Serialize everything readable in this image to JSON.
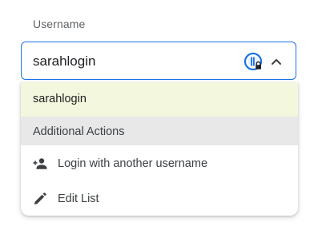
{
  "field": {
    "label": "Username",
    "value": "sarahlogin",
    "accent_color": "#1a73e8"
  },
  "icons": {
    "password_manager": "password-manager-lock-icon",
    "collapse": "chevron-up-icon"
  },
  "dropdown": {
    "suggestion": {
      "label": "sarahlogin",
      "highlight_color": "#f3f7dd"
    },
    "section_header": "Additional Actions",
    "actions": [
      {
        "label": "Login with another username",
        "icon": "add-person-icon"
      },
      {
        "label": "Edit List",
        "icon": "pencil-icon"
      }
    ]
  }
}
